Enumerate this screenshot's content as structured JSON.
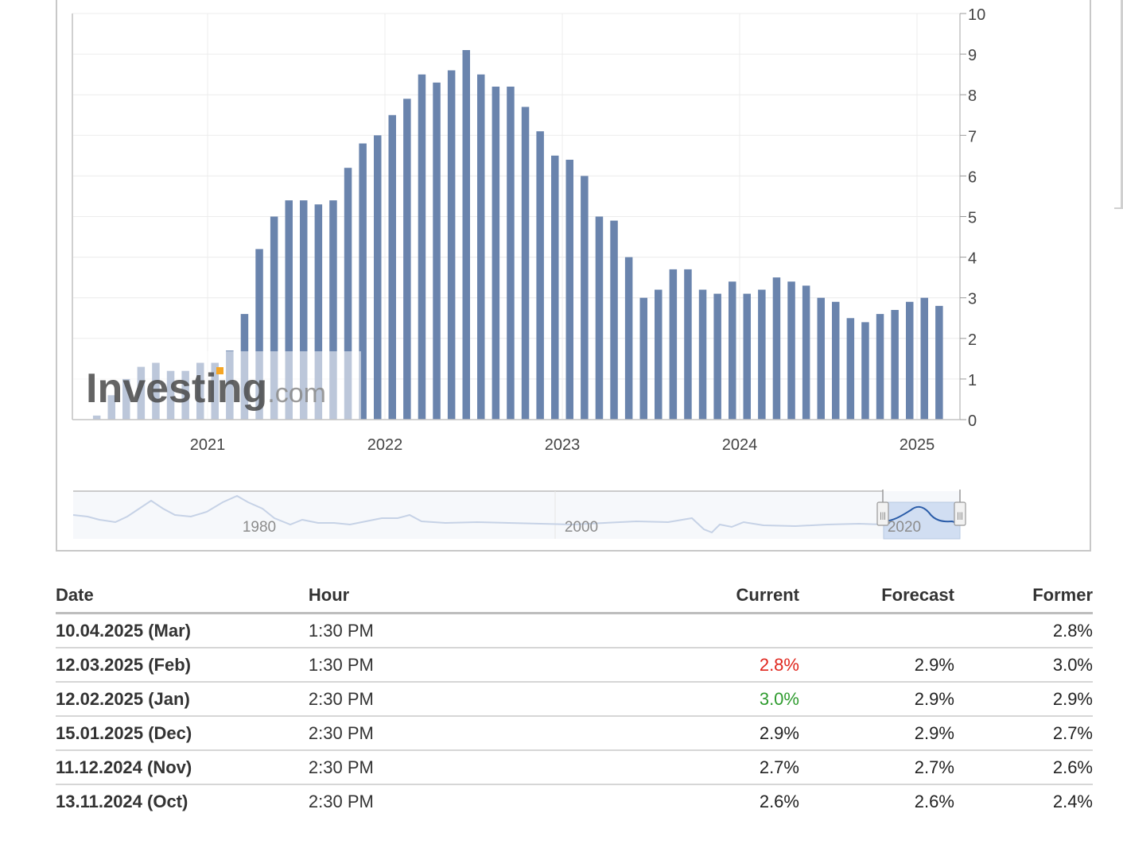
{
  "chart_data": {
    "type": "bar",
    "title": "",
    "xlabel": "",
    "ylabel": "",
    "ylim": [
      0,
      10
    ],
    "y_ticks": [
      "0",
      "1",
      "2",
      "3",
      "4",
      "5",
      "6",
      "7",
      "8",
      "9",
      "10"
    ],
    "x_ticks": [
      "2021",
      "2022",
      "2023",
      "2024",
      "2025"
    ],
    "grid": true,
    "y_axis_side": "right",
    "bar_color": "#6a84ad",
    "series": [
      {
        "x": [
          "2020-05",
          "2020-06",
          "2020-07",
          "2020-08",
          "2020-09",
          "2020-10",
          "2020-11",
          "2020-12",
          "2021-01",
          "2021-02",
          "2021-03",
          "2021-04",
          "2021-05",
          "2021-06",
          "2021-07",
          "2021-08",
          "2021-09",
          "2021-10",
          "2021-11",
          "2021-12",
          "2022-01",
          "2022-02",
          "2022-03",
          "2022-04",
          "2022-05",
          "2022-06",
          "2022-07",
          "2022-08",
          "2022-09",
          "2022-10",
          "2022-11",
          "2022-12",
          "2023-01",
          "2023-02",
          "2023-03",
          "2023-04",
          "2023-05",
          "2023-06",
          "2023-07",
          "2023-08",
          "2023-09",
          "2023-10",
          "2023-11",
          "2023-12",
          "2024-01",
          "2024-02",
          "2024-03",
          "2024-04",
          "2024-05",
          "2024-06",
          "2024-07",
          "2024-08",
          "2024-09",
          "2024-10",
          "2024-11",
          "2024-12",
          "2025-01",
          "2025-02"
        ],
        "values": [
          0.1,
          0.6,
          1.0,
          1.3,
          1.4,
          1.2,
          1.2,
          1.4,
          1.4,
          1.7,
          2.6,
          4.2,
          5.0,
          5.4,
          5.4,
          5.3,
          5.4,
          6.2,
          6.8,
          7.0,
          7.5,
          7.9,
          8.5,
          8.3,
          8.6,
          9.1,
          8.5,
          8.2,
          8.2,
          7.7,
          7.1,
          6.5,
          6.4,
          6.0,
          5.0,
          4.9,
          4.0,
          3.0,
          3.2,
          3.7,
          3.7,
          3.2,
          3.1,
          3.4,
          3.1,
          3.2,
          3.5,
          3.4,
          3.3,
          3.0,
          2.9,
          2.5,
          2.4,
          2.6,
          2.7,
          2.9,
          3.0,
          2.8
        ]
      }
    ]
  },
  "navigator": {
    "labels": [
      "1980",
      "2000",
      "2020"
    ],
    "handle_glyph": "|||"
  },
  "watermark": "Investing.com",
  "table": {
    "headers": {
      "date": "Date",
      "hour": "Hour",
      "current": "Current",
      "forecast": "Forecast",
      "former": "Former"
    },
    "rows": [
      {
        "date": "10.04.2025 (Mar)",
        "hour": "1:30 PM",
        "current": "",
        "current_status": "",
        "forecast": "",
        "former": "2.8%"
      },
      {
        "date": "12.03.2025 (Feb)",
        "hour": "1:30 PM",
        "current": "2.8%",
        "current_status": "down",
        "forecast": "2.9%",
        "former": "3.0%"
      },
      {
        "date": "12.02.2025 (Jan)",
        "hour": "2:30 PM",
        "current": "3.0%",
        "current_status": "up",
        "forecast": "2.9%",
        "former": "2.9%"
      },
      {
        "date": "15.01.2025 (Dec)",
        "hour": "2:30 PM",
        "current": "2.9%",
        "current_status": "",
        "forecast": "2.9%",
        "former": "2.7%"
      },
      {
        "date": "11.12.2024 (Nov)",
        "hour": "2:30 PM",
        "current": "2.7%",
        "current_status": "",
        "forecast": "2.7%",
        "former": "2.6%"
      },
      {
        "date": "13.11.2024 (Oct)",
        "hour": "2:30 PM",
        "current": "2.6%",
        "current_status": "",
        "forecast": "2.6%",
        "former": "2.4%"
      }
    ]
  }
}
